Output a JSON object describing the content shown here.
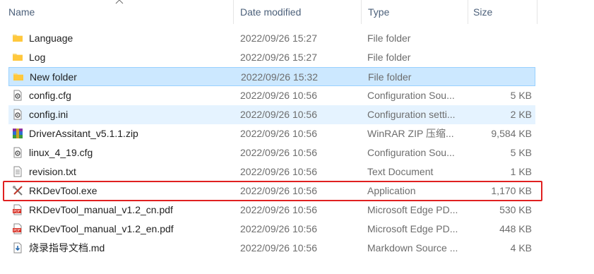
{
  "columns": {
    "name": "Name",
    "date": "Date modified",
    "type": "Type",
    "size": "Size"
  },
  "files": [
    {
      "name": "Language",
      "date": "2022/09/26 15:27",
      "type": "File folder",
      "size": "",
      "icon": "folder-icon"
    },
    {
      "name": "Log",
      "date": "2022/09/26 15:27",
      "type": "File folder",
      "size": "",
      "icon": "folder-icon"
    },
    {
      "name": "New folder",
      "date": "2022/09/26 15:32",
      "type": "File folder",
      "size": "",
      "icon": "folder-icon",
      "state": "selected"
    },
    {
      "name": "config.cfg",
      "date": "2022/09/26 10:56",
      "type": "Configuration Sou...",
      "size": "5 KB",
      "icon": "settings-file-icon"
    },
    {
      "name": "config.ini",
      "date": "2022/09/26 10:56",
      "type": "Configuration setti...",
      "size": "2 KB",
      "icon": "settings-file-icon",
      "state": "hover"
    },
    {
      "name": "DriverAssitant_v5.1.1.zip",
      "date": "2022/09/26 10:56",
      "type": "WinRAR ZIP 压缩...",
      "size": "9,584 KB",
      "icon": "winrar-icon"
    },
    {
      "name": "linux_4_19.cfg",
      "date": "2022/09/26 10:56",
      "type": "Configuration Sou...",
      "size": "5 KB",
      "icon": "settings-file-icon"
    },
    {
      "name": "revision.txt",
      "date": "2022/09/26 10:56",
      "type": "Text Document",
      "size": "1 KB",
      "icon": "text-file-icon"
    },
    {
      "name": "RKDevTool.exe",
      "date": "2022/09/26 10:56",
      "type": "Application",
      "size": "1,170 KB",
      "icon": "tools-icon",
      "state": "highlighted"
    },
    {
      "name": "RKDevTool_manual_v1.2_cn.pdf",
      "date": "2022/09/26 10:56",
      "type": "Microsoft Edge PD...",
      "size": "530 KB",
      "icon": "pdf-icon"
    },
    {
      "name": "RKDevTool_manual_v1.2_en.pdf",
      "date": "2022/09/26 10:56",
      "type": "Microsoft Edge PD...",
      "size": "448 KB",
      "icon": "pdf-icon"
    },
    {
      "name": "烧录指导文档.md",
      "date": "2022/09/26 10:56",
      "type": "Markdown Source ...",
      "size": "4 KB",
      "icon": "markdown-file-icon"
    }
  ],
  "colors": {
    "header_text": "#4c607a",
    "selected_bg": "#cce8ff",
    "hover_bg": "#e5f3ff",
    "highlight_border": "#e02020"
  }
}
